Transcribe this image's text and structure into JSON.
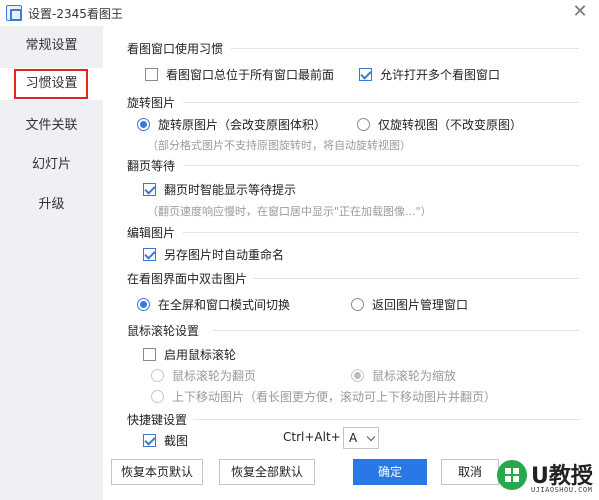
{
  "window": {
    "title": "设置-2345看图王",
    "close_glyph": "✕"
  },
  "sidebar": {
    "items": [
      {
        "label": "常规设置"
      },
      {
        "label": "习惯设置"
      },
      {
        "label": "文件关联"
      },
      {
        "label": "幻灯片"
      },
      {
        "label": "升级"
      }
    ],
    "active_index": 1
  },
  "sections": {
    "window_habit": {
      "title": "看图窗口使用习惯",
      "always_on_top": {
        "label": "看图窗口总位于所有窗口最前面",
        "checked": false
      },
      "multi_window": {
        "label": "允许打开多个看图窗口",
        "checked": true
      }
    },
    "rotate": {
      "title": "旋转图片",
      "rotate_original": {
        "label": "旋转原图片（会改变原图体积）",
        "checked": true
      },
      "rotate_view_only": {
        "label": "仅旋转视图（不改变原图）",
        "checked": false
      },
      "hint": "（部分格式图片不支持原图旋转时，将自动旋转视图）"
    },
    "page_wait": {
      "title": "翻页等待",
      "smart_wait": {
        "label": "翻页时智能显示等待提示",
        "checked": true
      },
      "hint": "（翻页速度响应慢时，在窗口居中显示\"正在加载图像...\"）"
    },
    "edit": {
      "title": "编辑图片",
      "auto_rename": {
        "label": "另存图片时自动重命名",
        "checked": true
      }
    },
    "double_click": {
      "title": "在看图界面中双击图片",
      "toggle_fullscreen": {
        "label": "在全屏和窗口模式间切换",
        "checked": true
      },
      "back_to_manager": {
        "label": "返回图片管理窗口",
        "checked": false
      }
    },
    "wheel": {
      "title": "鼠标滚轮设置",
      "enable_wheel": {
        "label": "启用鼠标滚轮",
        "checked": false
      },
      "wheel_page": {
        "label": "鼠标滚轮为翻页",
        "checked": false
      },
      "wheel_zoom": {
        "label": "鼠标滚轮为缩放",
        "checked": true
      },
      "scroll_image": {
        "label": "上下移动图片（看长图更方便，滚动可上下移动图片并翻页）",
        "checked": false
      }
    },
    "hotkey": {
      "title": "快捷键设置",
      "screenshot": {
        "label": "截图",
        "checked": true
      },
      "combo_label": "Ctrl+Alt+",
      "combo_key": "A"
    }
  },
  "buttons": {
    "restore_page": "恢复本页默认",
    "restore_all": "恢复全部默认",
    "ok": "确定",
    "cancel": "取消"
  },
  "watermark": {
    "brand": "U教授",
    "site": "UJIAOSHOU.COM"
  },
  "colors": {
    "accent": "#2a77e6",
    "highlight_box": "#e0251b",
    "sidebar_bg": "#eef0f3"
  }
}
